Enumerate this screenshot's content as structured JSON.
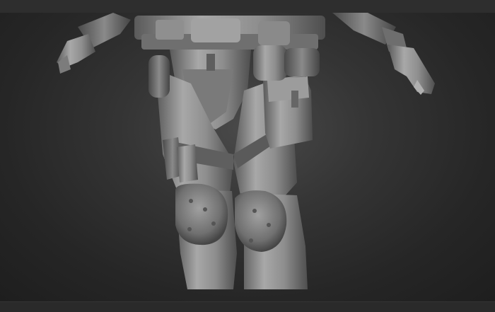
{
  "window": {
    "title": ""
  },
  "viewport": {
    "content": "3d-sculpt-model",
    "background_color": "#2b2b2b",
    "material_color": "#9a9a9a"
  },
  "ui_colors": {
    "top_bar": "#2e2e2e",
    "bottom_bar": "#2a2a2a"
  }
}
